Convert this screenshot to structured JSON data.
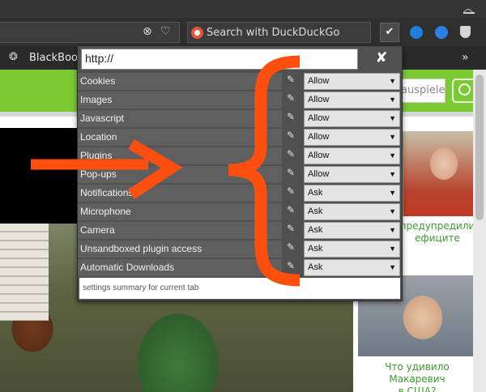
{
  "browser": {
    "search_placeholder": "Search with DuckDuckGo",
    "bookmark_label": "BlackBook",
    "overflow_label": "»",
    "extension_check": "✔"
  },
  "site": {
    "search_value": "auspiele",
    "caption1": "предупредили\nефиците",
    "caption2": "Что удивило Макаревич\nв США?"
  },
  "popup": {
    "url_value": "http://",
    "close_label": "✘",
    "footer": "settings summary for current tab",
    "permissions": [
      {
        "label": "Cookies",
        "value": "Allow"
      },
      {
        "label": "Images",
        "value": "Allow"
      },
      {
        "label": "Javascript",
        "value": "Allow"
      },
      {
        "label": "Location",
        "value": "Allow"
      },
      {
        "label": "Plugins",
        "value": "Allow"
      },
      {
        "label": "Pop-ups",
        "value": "Allow"
      },
      {
        "label": "Notifications",
        "value": "Ask"
      },
      {
        "label": "Microphone",
        "value": "Ask"
      },
      {
        "label": "Camera",
        "value": "Ask"
      },
      {
        "label": "Unsandboxed plugin access",
        "value": "Ask"
      },
      {
        "label": "Automatic Downloads",
        "value": "Ask"
      }
    ]
  },
  "colors": {
    "annotation": "#ff4f0f",
    "site_green": "#7acb33",
    "link_green": "#3a9c2d"
  },
  "icons": {
    "shield": "shield-icon",
    "heart": "heart-icon",
    "pencil": "pencil-icon",
    "dropdown": "chevron-down-icon"
  }
}
